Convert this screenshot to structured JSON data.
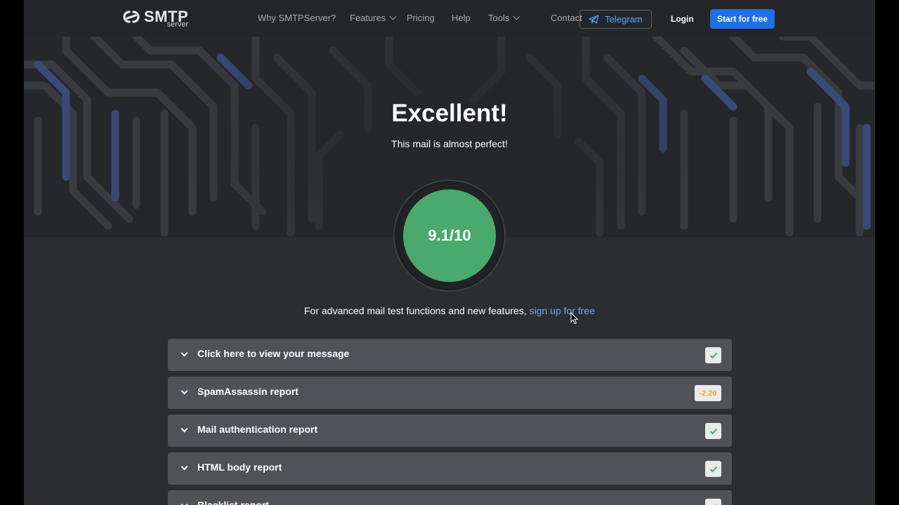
{
  "brand": {
    "name": "SMTP",
    "sub": "server"
  },
  "nav": {
    "items": [
      "Why SMTPServer?",
      "Features",
      "Pricing",
      "Help",
      "Tools",
      "Contact"
    ],
    "telegram": "Telegram",
    "login": "Login",
    "start": "Start for free"
  },
  "hero": {
    "title": "Excellent!",
    "subtitle": "This mail is almost perfect!"
  },
  "score": {
    "value": "9.1/10",
    "color": "#4aa96c"
  },
  "promo": {
    "text": "For advanced mail test functions and new features, ",
    "link": "sign up for free"
  },
  "reports": [
    {
      "label": "Click here to view your message",
      "status": "check"
    },
    {
      "label": "SpamAssassin report",
      "status": "-2.20"
    },
    {
      "label": "Mail authentication report",
      "status": "check"
    },
    {
      "label": "HTML body report",
      "status": "check"
    },
    {
      "label": "Blacklist report",
      "status": "check"
    }
  ],
  "colors": {
    "accent": "#1f6fe5",
    "link": "#6aa9f7",
    "warning": "#f0a53a",
    "success": "#4aa96c"
  }
}
